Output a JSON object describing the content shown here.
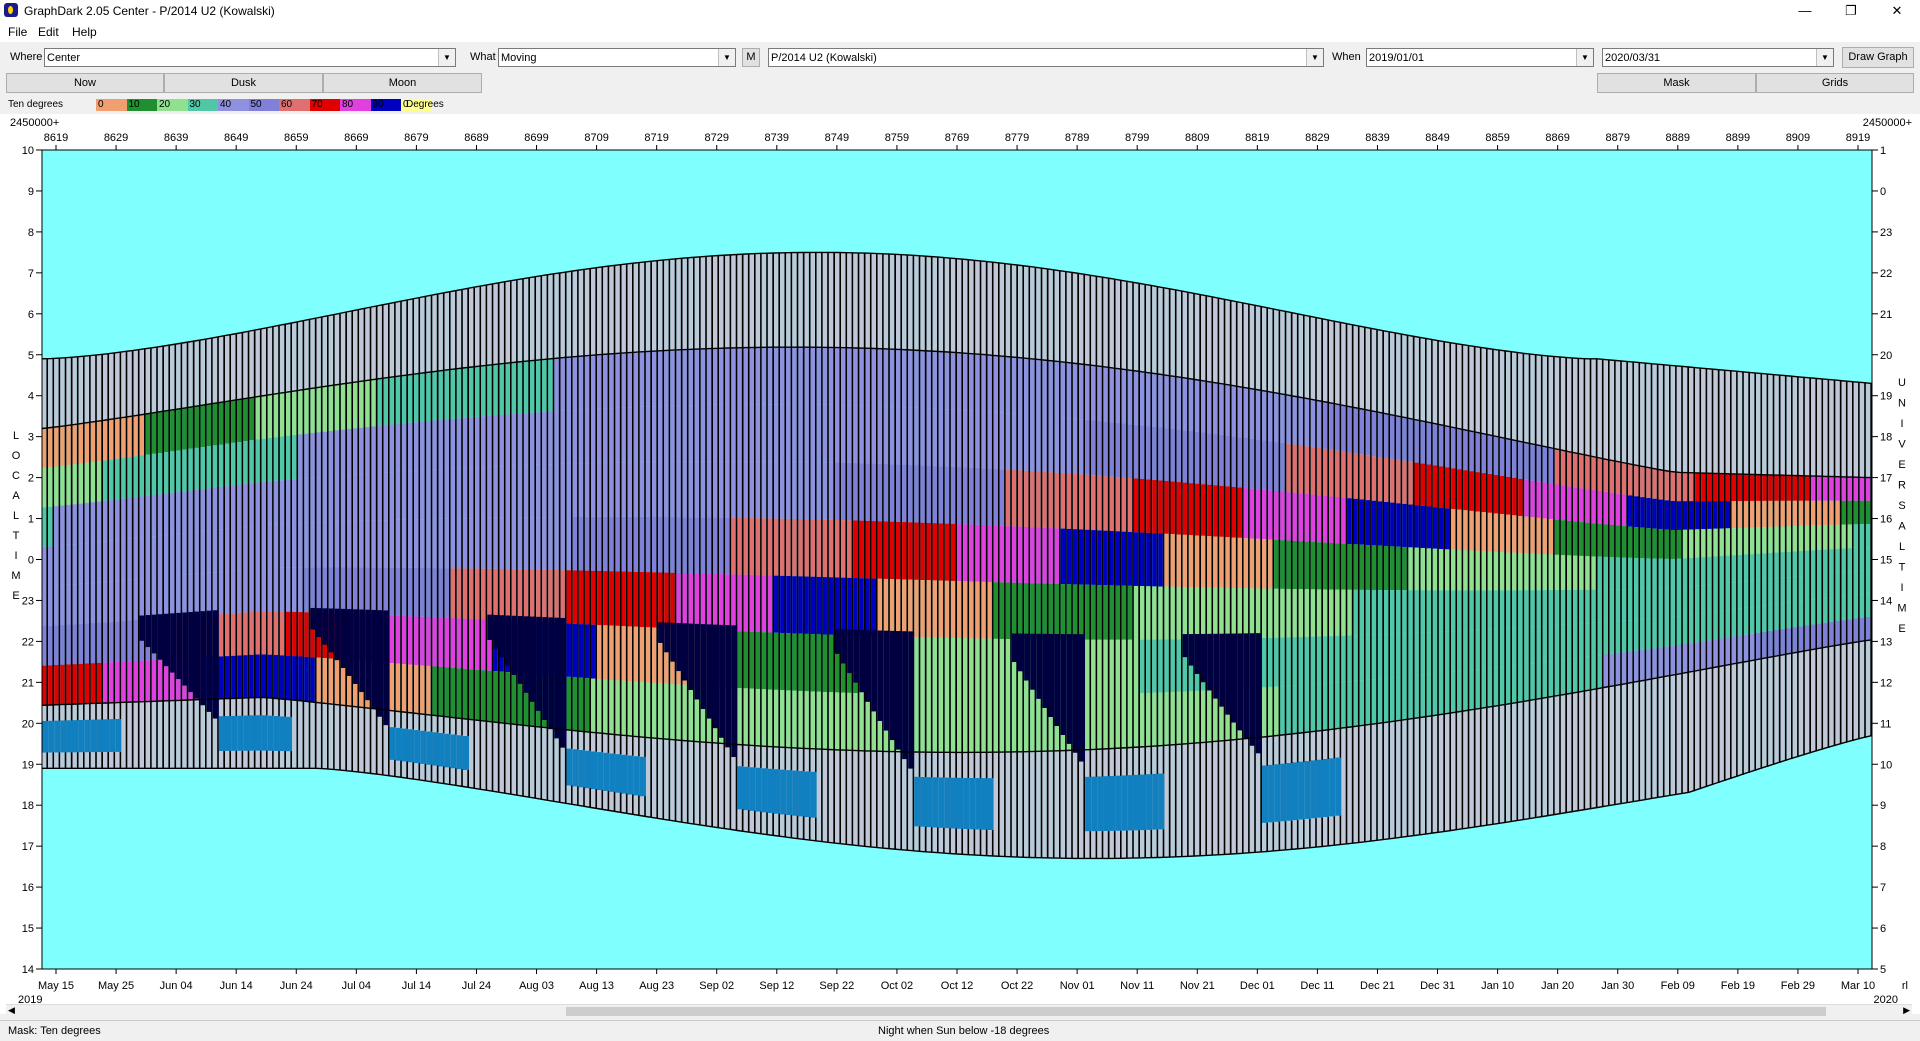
{
  "window": {
    "title": "GraphDark 2.05  Center  -  P/2014 U2 (Kowalski)"
  },
  "menu": [
    "File",
    "Edit",
    "Help"
  ],
  "toolbar": {
    "where_label": "Where",
    "where_value": "Center",
    "what_label": "What",
    "what_value": "Moving",
    "m_button": "M",
    "object_value": "P/2014 U2 (Kowalski)",
    "when_label": "When",
    "start_date": "2019/01/01",
    "end_date": "2020/03/31",
    "draw_button": "Draw Graph"
  },
  "buttons": {
    "now": "Now",
    "dusk": "Dusk",
    "moon": "Moon",
    "mask": "Mask",
    "grids": "Grids"
  },
  "legend": {
    "title": "Ten degrees",
    "swatches": [
      {
        "label": "0",
        "color": "#f0a070"
      },
      {
        "label": "10",
        "color": "#1f8f30"
      },
      {
        "label": "20",
        "color": "#90e090"
      },
      {
        "label": "30",
        "color": "#50c8a8"
      },
      {
        "label": "40",
        "color": "#9090e0"
      },
      {
        "label": "50",
        "color": "#8080d8"
      },
      {
        "label": "60",
        "color": "#e07070"
      },
      {
        "label": "70",
        "color": "#e00000"
      },
      {
        "label": "80",
        "color": "#e040e0"
      },
      {
        "label": "90",
        "color": "#0000c0"
      },
      {
        "label": "0",
        "color": "#ffff90"
      }
    ],
    "unit": "Degrees"
  },
  "chart": {
    "jd_prefix_left": "2450000+",
    "jd_prefix_right": "2450000+",
    "jd_ticks": [
      "8619",
      "8629",
      "8639",
      "8649",
      "8659",
      "8669",
      "8679",
      "8689",
      "8699",
      "8709",
      "8719",
      "8729",
      "8739",
      "8749",
      "8759",
      "8769",
      "8779",
      "8789",
      "8799",
      "8809",
      "8819",
      "8829",
      "8839",
      "8849",
      "8859",
      "8869",
      "8879",
      "8889",
      "8899",
      "8909",
      "8919"
    ],
    "date_ticks": [
      "May 15",
      "May 25",
      "Jun 04",
      "Jun 14",
      "Jun 24",
      "Jul 04",
      "Jul 14",
      "Jul 24",
      "Aug 03",
      "Aug 13",
      "Aug 23",
      "Sep 02",
      "Sep 12",
      "Sep 22",
      "Oct 02",
      "Oct 12",
      "Oct 22",
      "Nov 01",
      "Nov 11",
      "Nov 21",
      "Dec 01",
      "Dec 11",
      "Dec 21",
      "Dec 31",
      "Jan 10",
      "Jan 20",
      "Jan 30",
      "Feb 09",
      "Feb 19",
      "Feb 29",
      "Mar 10"
    ],
    "year_left": "2019",
    "year_right": "2020",
    "corner_right": "rl",
    "left_ticks": [
      "10",
      "9",
      "8",
      "7",
      "6",
      "5",
      "4",
      "3",
      "2",
      "1",
      "0",
      "23",
      "22",
      "21",
      "20",
      "19",
      "18",
      "17",
      "16",
      "15",
      "14"
    ],
    "right_ticks": [
      "1",
      "0",
      "23",
      "22",
      "21",
      "20",
      "19",
      "18",
      "17",
      "16",
      "15",
      "14",
      "13",
      "12",
      "11",
      "10",
      "9",
      "8",
      "7",
      "6",
      "5"
    ],
    "left_axis_label": "LOCAL TIME",
    "right_axis_label": "UNIVERSAL TIME",
    "sky_color": "#80ffff",
    "twilight_color": "#c0c8d8",
    "moon_color": "#1080c0",
    "dark_color": "#000040",
    "palette": [
      "#f0a070",
      "#1f8f30",
      "#90e090",
      "#50c8a8",
      "#9090e0",
      "#8080d8",
      "#e07070",
      "#e00000",
      "#e040e0",
      "#0000c0"
    ]
  },
  "status": {
    "mask": "Mask:  Ten degrees",
    "night": "Night when Sun below -18 degrees"
  }
}
